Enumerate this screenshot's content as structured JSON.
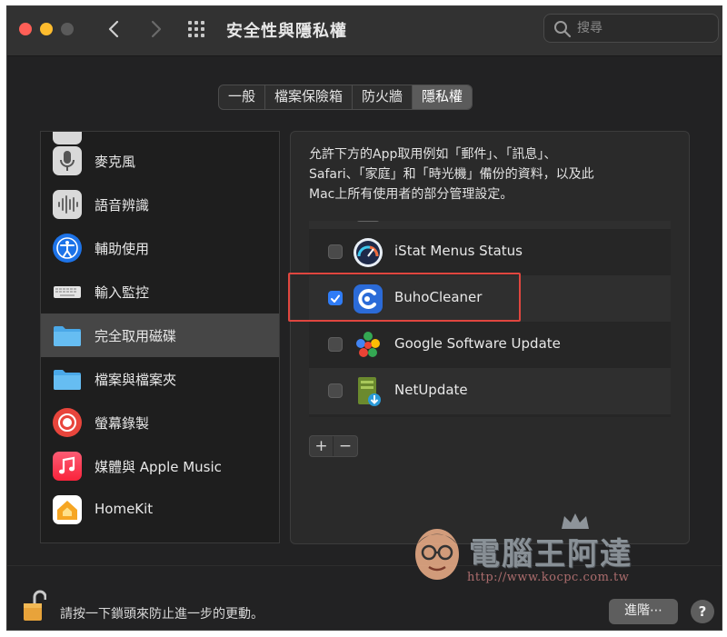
{
  "window": {
    "title": "安全性與隱私權"
  },
  "search": {
    "placeholder": "搜尋"
  },
  "tabs": [
    {
      "label": "一般",
      "active": false
    },
    {
      "label": "檔案保險箱",
      "active": false
    },
    {
      "label": "防火牆",
      "active": false
    },
    {
      "label": "隱私權",
      "active": true
    }
  ],
  "sidebar": {
    "items": [
      {
        "label": "麥克風",
        "icon": "microphone-icon"
      },
      {
        "label": "語音辨識",
        "icon": "speech-recognition-icon"
      },
      {
        "label": "輔助使用",
        "icon": "accessibility-icon"
      },
      {
        "label": "輸入監控",
        "icon": "keyboard-icon"
      },
      {
        "label": "完全取用磁碟",
        "icon": "folder-icon",
        "selected": true
      },
      {
        "label": "檔案與檔案夾",
        "icon": "folder-icon"
      },
      {
        "label": "螢幕錄製",
        "icon": "screen-record-icon"
      },
      {
        "label": "媒體與 Apple Music",
        "icon": "music-icon"
      },
      {
        "label": "HomeKit",
        "icon": "homekit-icon"
      }
    ]
  },
  "main": {
    "description_lines": [
      "允許下方的App取用例如「郵件」、「訊息」、",
      "Safari、「家庭」和「時光機」備份的資料，以及此",
      "Mac上所有使用者的部分管理設定。"
    ],
    "apps": [
      {
        "name": "iStat Menus Status",
        "checked": false,
        "icon": "istat-menus-icon"
      },
      {
        "name": "BuhoCleaner",
        "checked": true,
        "icon": "buhocleaner-icon"
      },
      {
        "name": "Google Software Update",
        "checked": false,
        "icon": "google-software-update-icon"
      },
      {
        "name": "NetUpdate",
        "checked": false,
        "icon": "netupdate-icon"
      }
    ],
    "add_label": "+",
    "remove_label": "−"
  },
  "footer": {
    "lock_text": "請按一下鎖頭來防止進一步的更動。",
    "advanced_label": "進階⋯",
    "help_label": "?"
  },
  "watermark": {
    "title": "電腦王阿達",
    "url": "http://www.kocpc.com.tw"
  },
  "colors": {
    "window_bg": "#222223",
    "accent": "#2f7cf6",
    "highlight_box": "#e0463f"
  }
}
